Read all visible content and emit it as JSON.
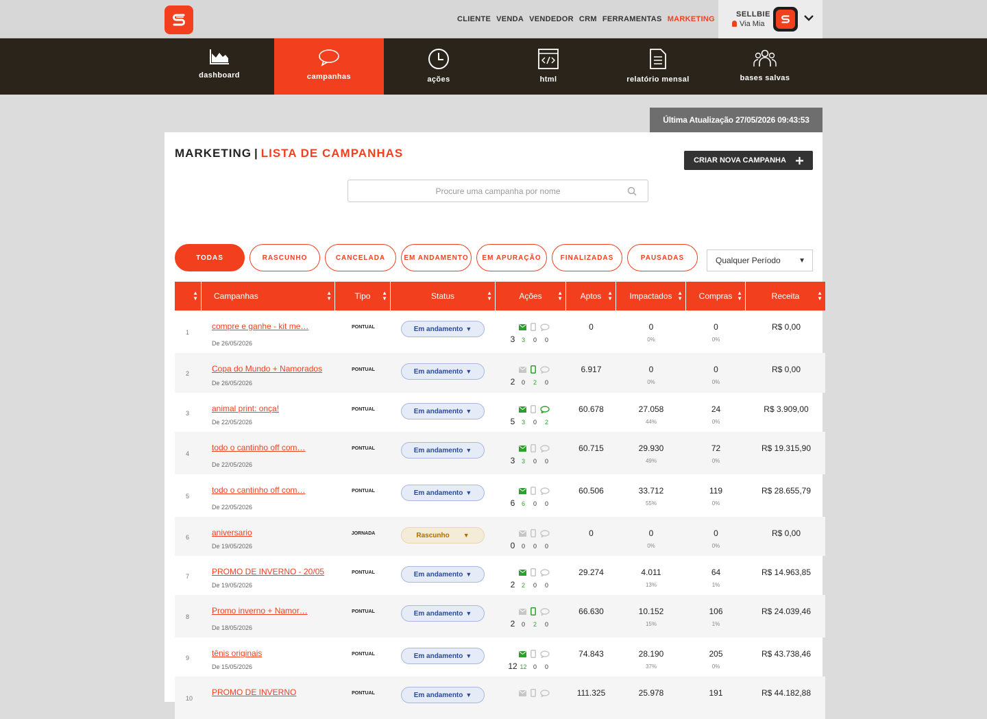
{
  "brand": {
    "accent": "#f2401f",
    "dark": "#2b241b"
  },
  "topnav": [
    "CLIENTE",
    "VENDA",
    "VENDEDOR",
    "CRM",
    "FERRAMENTAS",
    "MARKETING"
  ],
  "user": {
    "name": "SELLBIE",
    "store": "Via Mia"
  },
  "tabs": [
    "dashboard",
    "campanhas",
    "ações",
    "html",
    "relatório mensal",
    "bases salvas"
  ],
  "update_label": "Última Atualização 27/05/2026 09:43:53",
  "title": {
    "section": "MARKETING",
    "sep": "|",
    "page": "LISTA DE CAMPANHAS"
  },
  "new_button": "CRIAR NOVA CAMPANHA",
  "search_placeholder": "Procure uma campanha por nome",
  "filters": [
    "TODAS",
    "RASCUNHO",
    "CANCELADA",
    "EM ANDAMENTO",
    "EM APURAÇÃO",
    "FINALIZADAS",
    "PAUSADAS"
  ],
  "period": "Qualquer Período",
  "columns": [
    "Campanhas",
    "Tipo",
    "Status",
    "Ações",
    "Aptos",
    "Impactados",
    "Compras",
    "Receita"
  ],
  "campaigns": [
    {
      "n": "1",
      "name": "compre e ganhe - kit me…",
      "date": "De 26/05/2026",
      "tipo": "PONTUAL",
      "status": "Em andamento",
      "total": "3",
      "email": "3",
      "sms": "0",
      "wpp": "0",
      "aptos": "0",
      "impact": "0",
      "impact_pct": "0%",
      "compras": "0",
      "compras_pct": "0%",
      "receita": "R$ 0,00"
    },
    {
      "n": "2",
      "name": "Copa do Mundo + Namorados",
      "date": "De 26/05/2026",
      "tipo": "PONTUAL",
      "status": "Em andamento",
      "total": "2",
      "email": "0",
      "sms": "2",
      "wpp": "0",
      "aptos": "6.917",
      "impact": "0",
      "impact_pct": "0%",
      "compras": "0",
      "compras_pct": "0%",
      "receita": "R$ 0,00"
    },
    {
      "n": "3",
      "name": "animal print: onça!",
      "date": "De 22/05/2026",
      "tipo": "PONTUAL",
      "status": "Em andamento",
      "total": "5",
      "email": "3",
      "sms": "0",
      "wpp": "2",
      "aptos": "60.678",
      "impact": "27.058",
      "impact_pct": "44%",
      "compras": "24",
      "compras_pct": "0%",
      "receita": "R$ 3.909,00"
    },
    {
      "n": "4",
      "name": "todo o cantinho off com…",
      "date": "De 22/05/2026",
      "tipo": "PONTUAL",
      "status": "Em andamento",
      "total": "3",
      "email": "3",
      "sms": "0",
      "wpp": "0",
      "aptos": "60.715",
      "impact": "29.930",
      "impact_pct": "49%",
      "compras": "72",
      "compras_pct": "0%",
      "receita": "R$ 19.315,90"
    },
    {
      "n": "5",
      "name": "todo o cantinho off com…",
      "date": "De 22/05/2026",
      "tipo": "PONTUAL",
      "status": "Em andamento",
      "total": "6",
      "email": "6",
      "sms": "0",
      "wpp": "0",
      "aptos": "60.506",
      "impact": "33.712",
      "impact_pct": "55%",
      "compras": "119",
      "compras_pct": "0%",
      "receita": "R$ 28.655,79"
    },
    {
      "n": "6",
      "name": "aniversario",
      "date": "De 19/05/2026",
      "tipo": "JORNADA",
      "status": "Rascunho",
      "total": "0",
      "email": "0",
      "sms": "0",
      "wpp": "0",
      "aptos": "0",
      "impact": "0",
      "impact_pct": "0%",
      "compras": "0",
      "compras_pct": "0%",
      "receita": "R$ 0,00"
    },
    {
      "n": "7",
      "name": "PROMO DE INVERNO - 20/05",
      "date": "De 19/05/2026",
      "tipo": "PONTUAL",
      "status": "Em andamento",
      "total": "2",
      "email": "2",
      "sms": "0",
      "wpp": "0",
      "aptos": "29.274",
      "impact": "4.011",
      "impact_pct": "13%",
      "compras": "64",
      "compras_pct": "1%",
      "receita": "R$ 14.963,85"
    },
    {
      "n": "8",
      "name": "Promo inverno + Namor…",
      "date": "De 18/05/2026",
      "tipo": "PONTUAL",
      "status": "Em andamento",
      "total": "2",
      "email": "0",
      "sms": "2",
      "wpp": "0",
      "aptos": "66.630",
      "impact": "10.152",
      "impact_pct": "15%",
      "compras": "106",
      "compras_pct": "1%",
      "receita": "R$ 24.039,46"
    },
    {
      "n": "9",
      "name": "tênis originais",
      "date": "De 15/05/2026",
      "tipo": "PONTUAL",
      "status": "Em andamento",
      "total": "12",
      "email": "12",
      "sms": "0",
      "wpp": "0",
      "aptos": "74.843",
      "impact": "28.190",
      "impact_pct": "37%",
      "compras": "205",
      "compras_pct": "0%",
      "receita": "R$ 43.738,46"
    },
    {
      "n": "10",
      "name": "PROMO DE INVERNO",
      "date": "",
      "tipo": "PONTUAL",
      "status": "Em andamento",
      "total": "",
      "email": "",
      "sms": "",
      "wpp": "",
      "aptos": "111.325",
      "impact": "25.978",
      "impact_pct": "",
      "compras": "191",
      "compras_pct": "",
      "receita": "R$ 44.182,88"
    }
  ]
}
